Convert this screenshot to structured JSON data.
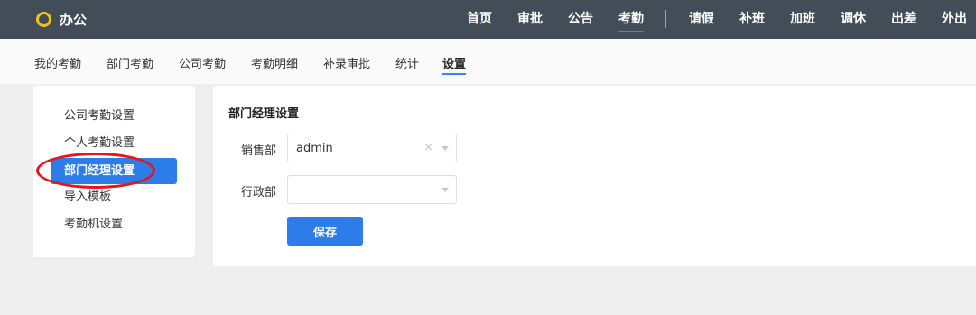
{
  "app": {
    "title": "办公",
    "accent": "#2d7de8",
    "logo_color": "#f4c21b",
    "annotation_color": "#e8141c"
  },
  "topnav": {
    "items": [
      {
        "label": "首页"
      },
      {
        "label": "审批"
      },
      {
        "label": "公告"
      },
      {
        "label": "考勤",
        "active": true
      },
      {
        "label": "请假"
      },
      {
        "label": "补班"
      },
      {
        "label": "加班"
      },
      {
        "label": "调休"
      },
      {
        "label": "出差"
      },
      {
        "label": "外出"
      }
    ]
  },
  "subnav": {
    "items": [
      {
        "label": "我的考勤"
      },
      {
        "label": "部门考勤"
      },
      {
        "label": "公司考勤"
      },
      {
        "label": "考勤明细"
      },
      {
        "label": "补录审批"
      },
      {
        "label": "统计"
      },
      {
        "label": "设置",
        "active": true
      }
    ]
  },
  "sidebar": {
    "items": [
      {
        "label": "公司考勤设置"
      },
      {
        "label": "个人考勤设置"
      },
      {
        "label": "部门经理设置",
        "active": true
      },
      {
        "label": "导入模板"
      },
      {
        "label": "考勤机设置"
      }
    ]
  },
  "main": {
    "title": "部门经理设置",
    "fields": [
      {
        "label": "销售部",
        "value": "admin",
        "clear_icon": "close-icon"
      },
      {
        "label": "行政部",
        "value": ""
      }
    ],
    "save_label": "保存"
  }
}
